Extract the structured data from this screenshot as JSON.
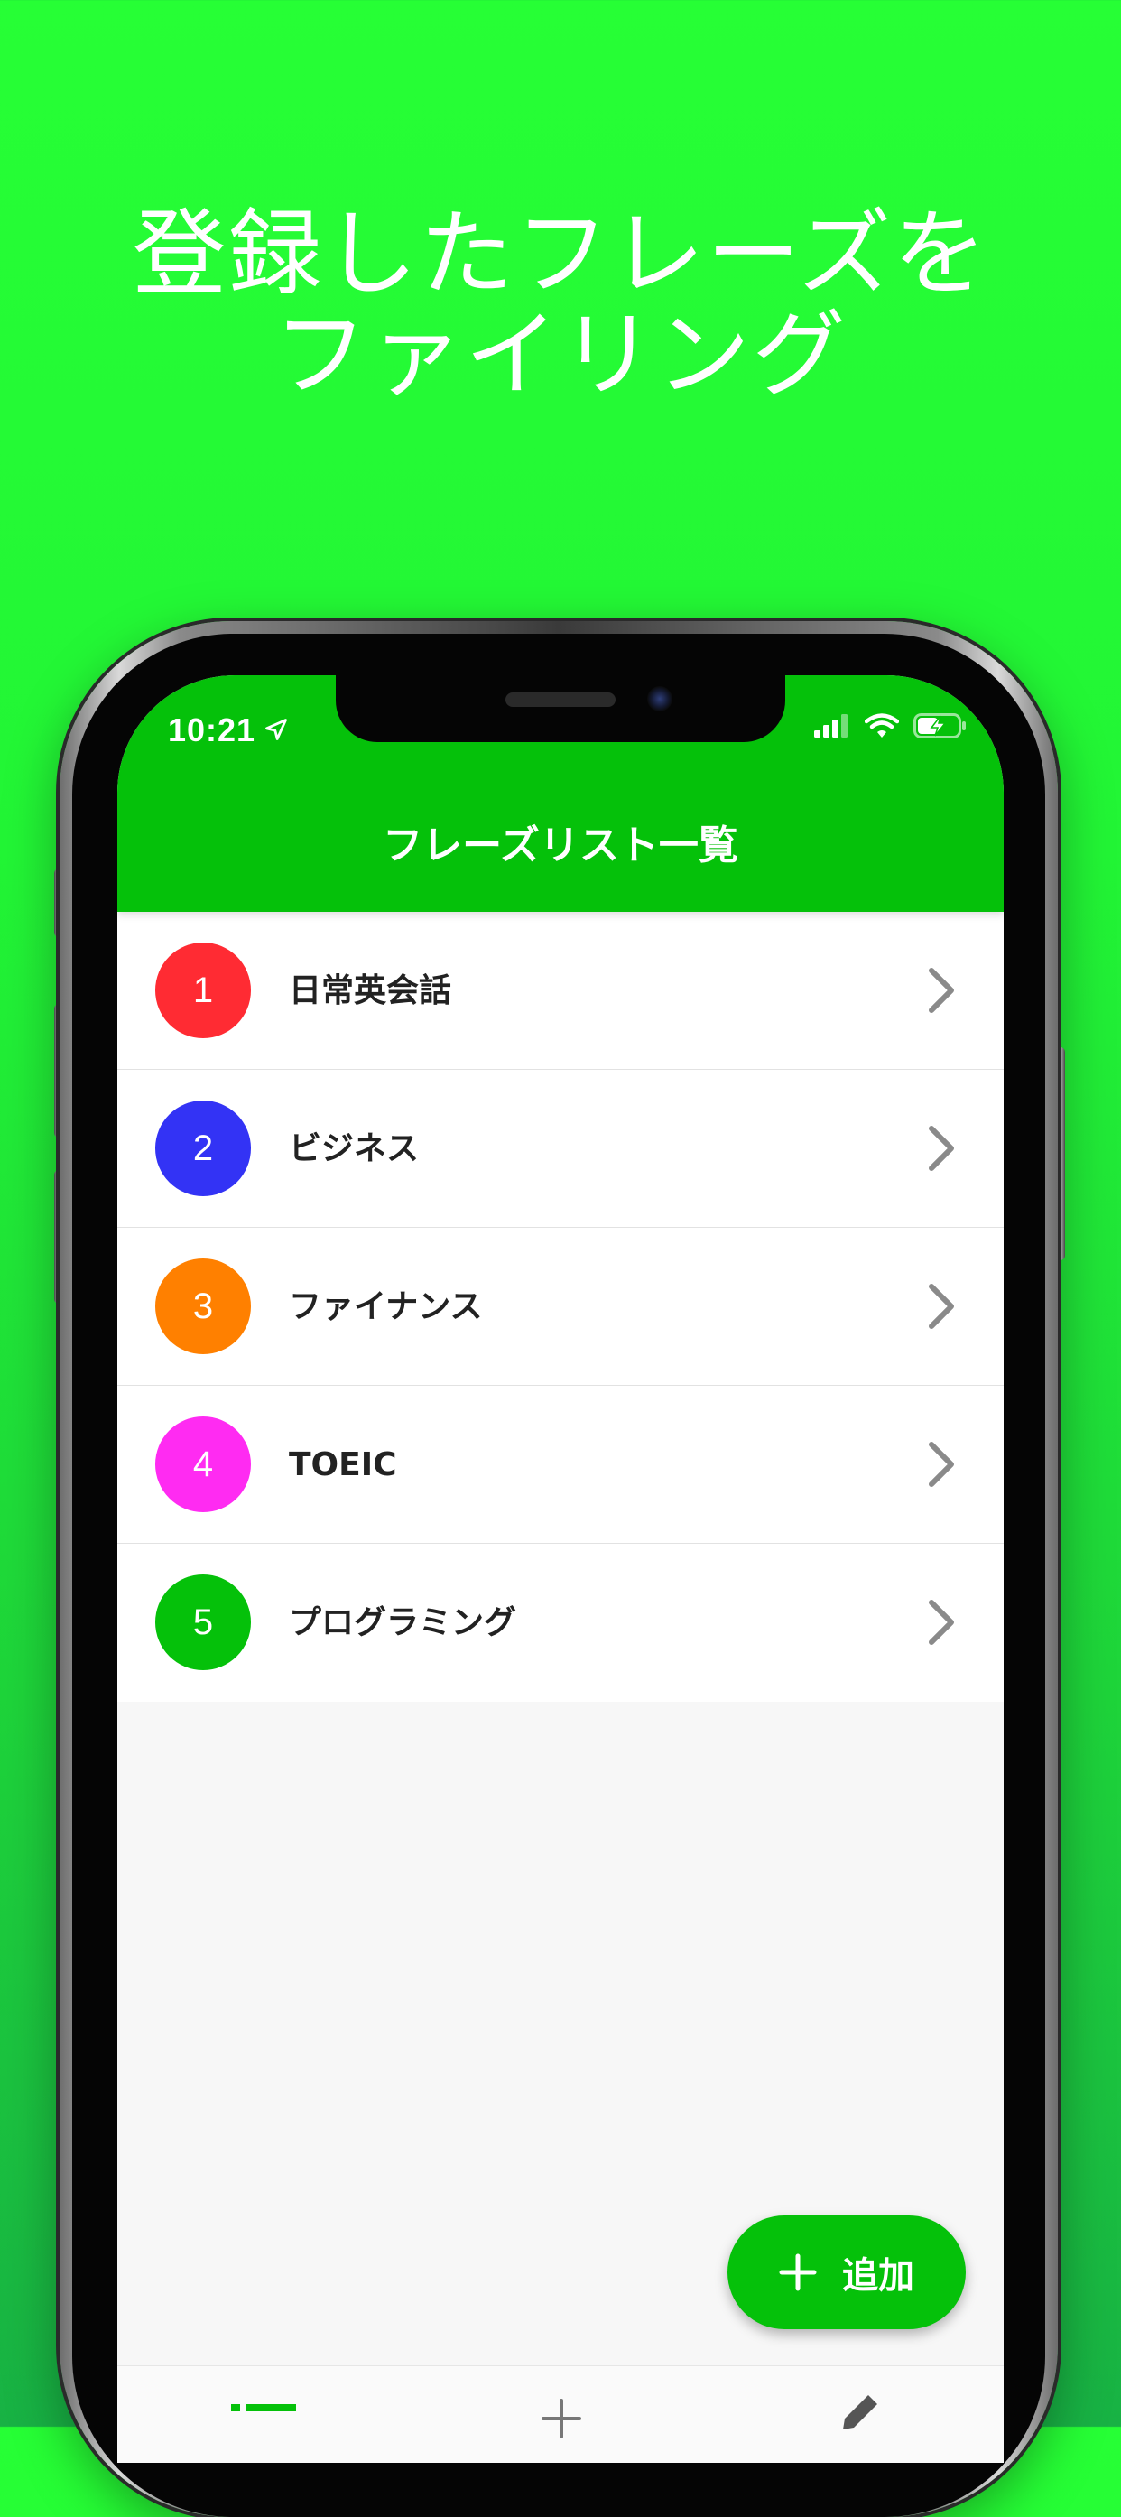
{
  "headline": {
    "line1": "登録したフレーズを",
    "line2": "ファイリング"
  },
  "status_bar": {
    "time": "10:21",
    "icons": [
      "location-arrow-icon",
      "signal-icon",
      "wifi-icon",
      "battery-charging-icon"
    ]
  },
  "app_bar": {
    "title": "フレーズリスト一覧"
  },
  "phrase_lists": [
    {
      "number": "1",
      "label": "日常英会話",
      "color": "#ff2b33"
    },
    {
      "number": "2",
      "label": "ビジネス",
      "color": "#3333f5"
    },
    {
      "number": "3",
      "label": "ファイナンス",
      "color": "#ff8000"
    },
    {
      "number": "4",
      "label": "TOEIC",
      "color": "#ff2bf2"
    },
    {
      "number": "5",
      "label": "プログラミング",
      "color": "#05c10a"
    }
  ],
  "fab": {
    "label": "追加",
    "icon": "plus-icon"
  },
  "tabbar": {
    "icons": [
      "list-icon",
      "add-icon",
      "edit-icon"
    ]
  },
  "colors": {
    "brand_green": "#05c10a",
    "background_green": "#26ff35"
  }
}
